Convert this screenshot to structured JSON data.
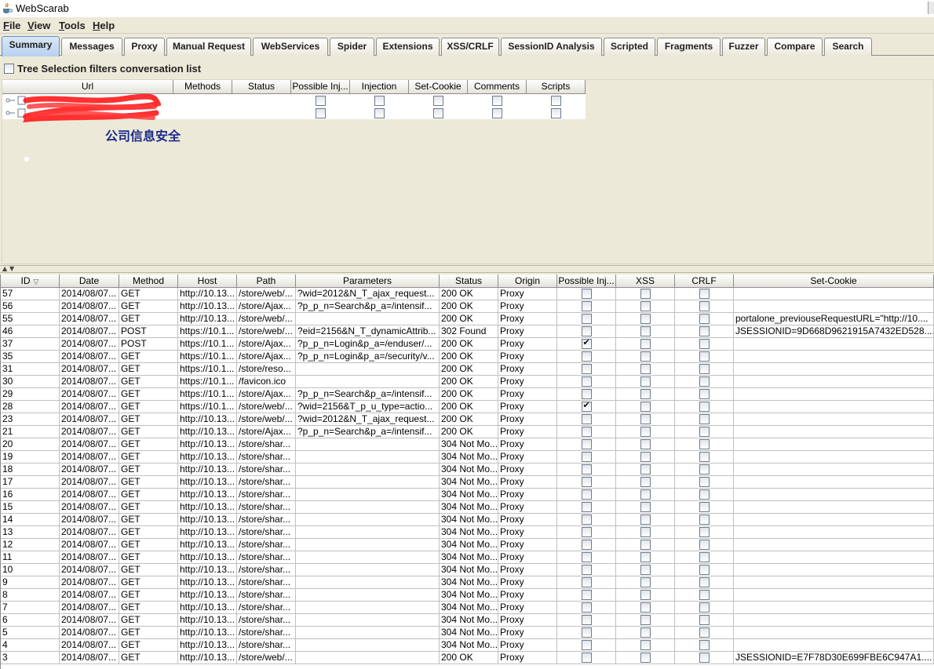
{
  "window": {
    "title": "WebScarab",
    "icon": "java-cup-icon"
  },
  "menu": [
    "File",
    "View",
    "Tools",
    "Help"
  ],
  "tabs": [
    "Summary",
    "Messages",
    "Proxy",
    "Manual Request",
    "WebServices",
    "Spider",
    "Extensions",
    "XSS/CRLF",
    "SessionID Analysis",
    "Scripted",
    "Fragments",
    "Fuzzer",
    "Compare",
    "Search"
  ],
  "active_tab": "Summary",
  "filter": {
    "label": "Tree Selection filters conversation list",
    "checked": false
  },
  "tree_table": {
    "headers": [
      "Url",
      "Methods",
      "Status",
      "Possible Inj...",
      "Injection",
      "Set-Cookie",
      "Comments",
      "Scripts"
    ],
    "row_count": 2
  },
  "watermark": "公司信息安全",
  "conversations": {
    "headers": [
      "ID",
      "Date",
      "Method",
      "Host",
      "Path",
      "Parameters",
      "Status",
      "Origin",
      "Possible Inj...",
      "XSS",
      "CRLF",
      "Set-Cookie"
    ],
    "rows": [
      {
        "id": "57",
        "date": "2014/08/07...",
        "method": "GET",
        "host": "http://10.13...",
        "path": "/store/web/...",
        "params": "?wid=2012&N_T_ajax_request...",
        "status": "200 OK",
        "origin": "Proxy",
        "pi": false,
        "xss": false,
        "crlf": false,
        "cookie": ""
      },
      {
        "id": "56",
        "date": "2014/08/07...",
        "method": "GET",
        "host": "http://10.13...",
        "path": "/store/Ajax...",
        "params": "?p_p_n=Search&p_a=/intensif...",
        "status": "200 OK",
        "origin": "Proxy",
        "pi": false,
        "xss": false,
        "crlf": false,
        "cookie": ""
      },
      {
        "id": "55",
        "date": "2014/08/07...",
        "method": "GET",
        "host": "http://10.13...",
        "path": "/store/web/...",
        "params": "",
        "status": "200 OK",
        "origin": "Proxy",
        "pi": false,
        "xss": false,
        "crlf": false,
        "cookie": "portalone_previouseRequestURL=\"http://10...."
      },
      {
        "id": "46",
        "date": "2014/08/07...",
        "method": "POST",
        "host": "https://10.1...",
        "path": "/store/web/...",
        "params": "?eid=2156&N_T_dynamicAttrib...",
        "status": "302 Found",
        "origin": "Proxy",
        "pi": false,
        "xss": false,
        "crlf": false,
        "cookie": "JSESSIONID=9D668D9621915A7432ED528...."
      },
      {
        "id": "37",
        "date": "2014/08/07...",
        "method": "POST",
        "host": "https://10.1...",
        "path": "/store/Ajax...",
        "params": "?p_p_n=Login&p_a=/enduser/...",
        "status": "200 OK",
        "origin": "Proxy",
        "pi": true,
        "xss": false,
        "crlf": false,
        "cookie": ""
      },
      {
        "id": "35",
        "date": "2014/08/07...",
        "method": "GET",
        "host": "https://10.1...",
        "path": "/store/Ajax...",
        "params": "?p_p_n=Login&p_a=/security/v...",
        "status": "200 OK",
        "origin": "Proxy",
        "pi": false,
        "xss": false,
        "crlf": false,
        "cookie": ""
      },
      {
        "id": "31",
        "date": "2014/08/07...",
        "method": "GET",
        "host": "https://10.1...",
        "path": "/store/reso...",
        "params": "",
        "status": "200 OK",
        "origin": "Proxy",
        "pi": false,
        "xss": false,
        "crlf": false,
        "cookie": ""
      },
      {
        "id": "30",
        "date": "2014/08/07...",
        "method": "GET",
        "host": "https://10.1...",
        "path": "/favicon.ico",
        "params": "",
        "status": "200 OK",
        "origin": "Proxy",
        "pi": false,
        "xss": false,
        "crlf": false,
        "cookie": ""
      },
      {
        "id": "29",
        "date": "2014/08/07...",
        "method": "GET",
        "host": "https://10.1...",
        "path": "/store/Ajax...",
        "params": "?p_p_n=Search&p_a=/intensif...",
        "status": "200 OK",
        "origin": "Proxy",
        "pi": false,
        "xss": false,
        "crlf": false,
        "cookie": ""
      },
      {
        "id": "28",
        "date": "2014/08/07...",
        "method": "GET",
        "host": "https://10.1...",
        "path": "/store/web/...",
        "params": "?wid=2156&T_p_u_type=actio...",
        "status": "200 OK",
        "origin": "Proxy",
        "pi": true,
        "xss": false,
        "crlf": false,
        "cookie": ""
      },
      {
        "id": "23",
        "date": "2014/08/07...",
        "method": "GET",
        "host": "http://10.13...",
        "path": "/store/web/...",
        "params": "?wid=2012&N_T_ajax_request...",
        "status": "200 OK",
        "origin": "Proxy",
        "pi": false,
        "xss": false,
        "crlf": false,
        "cookie": ""
      },
      {
        "id": "21",
        "date": "2014/08/07...",
        "method": "GET",
        "host": "http://10.13...",
        "path": "/store/Ajax...",
        "params": "?p_p_n=Search&p_a=/intensif...",
        "status": "200 OK",
        "origin": "Proxy",
        "pi": false,
        "xss": false,
        "crlf": false,
        "cookie": ""
      },
      {
        "id": "20",
        "date": "2014/08/07...",
        "method": "GET",
        "host": "http://10.13...",
        "path": "/store/shar...",
        "params": "",
        "status": "304 Not Mo...",
        "origin": "Proxy",
        "pi": false,
        "xss": false,
        "crlf": false,
        "cookie": ""
      },
      {
        "id": "19",
        "date": "2014/08/07...",
        "method": "GET",
        "host": "http://10.13...",
        "path": "/store/shar...",
        "params": "",
        "status": "304 Not Mo...",
        "origin": "Proxy",
        "pi": false,
        "xss": false,
        "crlf": false,
        "cookie": ""
      },
      {
        "id": "18",
        "date": "2014/08/07...",
        "method": "GET",
        "host": "http://10.13...",
        "path": "/store/shar...",
        "params": "",
        "status": "304 Not Mo...",
        "origin": "Proxy",
        "pi": false,
        "xss": false,
        "crlf": false,
        "cookie": ""
      },
      {
        "id": "17",
        "date": "2014/08/07...",
        "method": "GET",
        "host": "http://10.13...",
        "path": "/store/shar...",
        "params": "",
        "status": "304 Not Mo...",
        "origin": "Proxy",
        "pi": false,
        "xss": false,
        "crlf": false,
        "cookie": ""
      },
      {
        "id": "16",
        "date": "2014/08/07...",
        "method": "GET",
        "host": "http://10.13...",
        "path": "/store/shar...",
        "params": "",
        "status": "304 Not Mo...",
        "origin": "Proxy",
        "pi": false,
        "xss": false,
        "crlf": false,
        "cookie": ""
      },
      {
        "id": "15",
        "date": "2014/08/07...",
        "method": "GET",
        "host": "http://10.13...",
        "path": "/store/shar...",
        "params": "",
        "status": "304 Not Mo...",
        "origin": "Proxy",
        "pi": false,
        "xss": false,
        "crlf": false,
        "cookie": ""
      },
      {
        "id": "14",
        "date": "2014/08/07...",
        "method": "GET",
        "host": "http://10.13...",
        "path": "/store/shar...",
        "params": "",
        "status": "304 Not Mo...",
        "origin": "Proxy",
        "pi": false,
        "xss": false,
        "crlf": false,
        "cookie": ""
      },
      {
        "id": "13",
        "date": "2014/08/07...",
        "method": "GET",
        "host": "http://10.13...",
        "path": "/store/shar...",
        "params": "",
        "status": "304 Not Mo...",
        "origin": "Proxy",
        "pi": false,
        "xss": false,
        "crlf": false,
        "cookie": ""
      },
      {
        "id": "12",
        "date": "2014/08/07...",
        "method": "GET",
        "host": "http://10.13...",
        "path": "/store/shar...",
        "params": "",
        "status": "304 Not Mo...",
        "origin": "Proxy",
        "pi": false,
        "xss": false,
        "crlf": false,
        "cookie": ""
      },
      {
        "id": "11",
        "date": "2014/08/07...",
        "method": "GET",
        "host": "http://10.13...",
        "path": "/store/shar...",
        "params": "",
        "status": "304 Not Mo...",
        "origin": "Proxy",
        "pi": false,
        "xss": false,
        "crlf": false,
        "cookie": ""
      },
      {
        "id": "10",
        "date": "2014/08/07...",
        "method": "GET",
        "host": "http://10.13...",
        "path": "/store/shar...",
        "params": "",
        "status": "304 Not Mo...",
        "origin": "Proxy",
        "pi": false,
        "xss": false,
        "crlf": false,
        "cookie": ""
      },
      {
        "id": "9",
        "date": "2014/08/07...",
        "method": "GET",
        "host": "http://10.13...",
        "path": "/store/shar...",
        "params": "",
        "status": "304 Not Mo...",
        "origin": "Proxy",
        "pi": false,
        "xss": false,
        "crlf": false,
        "cookie": ""
      },
      {
        "id": "8",
        "date": "2014/08/07...",
        "method": "GET",
        "host": "http://10.13...",
        "path": "/store/shar...",
        "params": "",
        "status": "304 Not Mo...",
        "origin": "Proxy",
        "pi": false,
        "xss": false,
        "crlf": false,
        "cookie": ""
      },
      {
        "id": "7",
        "date": "2014/08/07...",
        "method": "GET",
        "host": "http://10.13...",
        "path": "/store/shar...",
        "params": "",
        "status": "304 Not Mo...",
        "origin": "Proxy",
        "pi": false,
        "xss": false,
        "crlf": false,
        "cookie": ""
      },
      {
        "id": "6",
        "date": "2014/08/07...",
        "method": "GET",
        "host": "http://10.13...",
        "path": "/store/shar...",
        "params": "",
        "status": "304 Not Mo...",
        "origin": "Proxy",
        "pi": false,
        "xss": false,
        "crlf": false,
        "cookie": ""
      },
      {
        "id": "5",
        "date": "2014/08/07...",
        "method": "GET",
        "host": "http://10.13...",
        "path": "/store/shar...",
        "params": "",
        "status": "304 Not Mo...",
        "origin": "Proxy",
        "pi": false,
        "xss": false,
        "crlf": false,
        "cookie": ""
      },
      {
        "id": "4",
        "date": "2014/08/07...",
        "method": "GET",
        "host": "http://10.13...",
        "path": "/store/shar...",
        "params": "",
        "status": "304 Not Mo...",
        "origin": "Proxy",
        "pi": false,
        "xss": false,
        "crlf": false,
        "cookie": ""
      },
      {
        "id": "3",
        "date": "2014/08/07...",
        "method": "GET",
        "host": "http://10.13...",
        "path": "/store/web/...",
        "params": "",
        "status": "200 OK",
        "origin": "Proxy",
        "pi": false,
        "xss": false,
        "crlf": false,
        "cookie": "JSESSIONID=E7F78D30E699FBE6C947A1...."
      }
    ]
  }
}
